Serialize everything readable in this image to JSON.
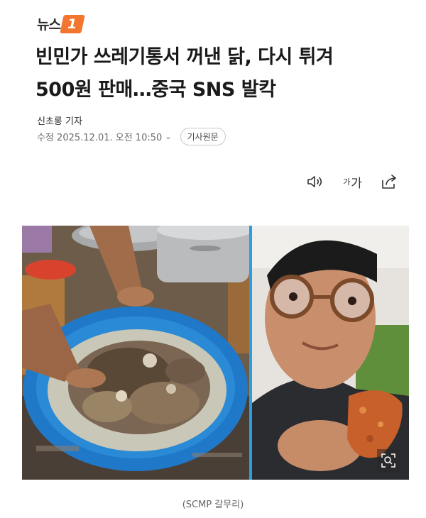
{
  "header": {
    "logo_text": "뉴스",
    "logo_badge": "1"
  },
  "article": {
    "headline_line1": "빈민가 쓰레기통서 꺼낸 닭, 다시 튀겨",
    "headline_line2": "500원 판매…중국 SNS 발칵",
    "reporter": "신초롱 기자",
    "modified": "수정 2025.12.01. 오전 10:50",
    "original_button": "기사원문"
  },
  "toolbar": {
    "font_small": "가",
    "font_large": "가",
    "icons": [
      "speaker-icon",
      "font-size-icon",
      "share-icon"
    ]
  },
  "photo": {
    "caption": "(SCMP 갈무리)",
    "zoom_icon": "zoom-search-icon"
  },
  "colors": {
    "brand": "#f2762e",
    "basin": "#1e7fd0",
    "divider": "#2a9fe0"
  }
}
